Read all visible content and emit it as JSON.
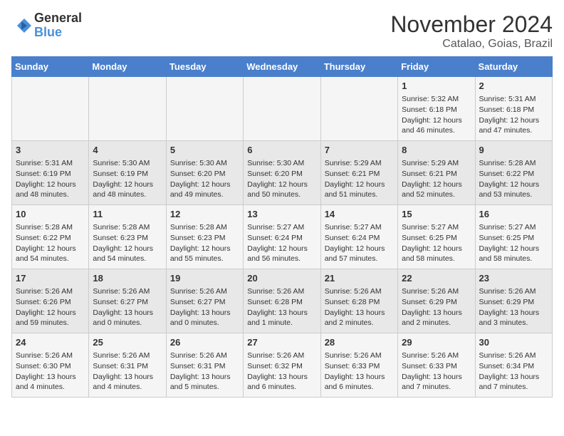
{
  "header": {
    "logo_line1": "General",
    "logo_line2": "Blue",
    "month": "November 2024",
    "location": "Catalao, Goias, Brazil"
  },
  "days_of_week": [
    "Sunday",
    "Monday",
    "Tuesday",
    "Wednesday",
    "Thursday",
    "Friday",
    "Saturday"
  ],
  "weeks": [
    [
      {
        "day": "",
        "content": ""
      },
      {
        "day": "",
        "content": ""
      },
      {
        "day": "",
        "content": ""
      },
      {
        "day": "",
        "content": ""
      },
      {
        "day": "",
        "content": ""
      },
      {
        "day": "1",
        "content": "Sunrise: 5:32 AM\nSunset: 6:18 PM\nDaylight: 12 hours and 46 minutes."
      },
      {
        "day": "2",
        "content": "Sunrise: 5:31 AM\nSunset: 6:18 PM\nDaylight: 12 hours and 47 minutes."
      }
    ],
    [
      {
        "day": "3",
        "content": "Sunrise: 5:31 AM\nSunset: 6:19 PM\nDaylight: 12 hours and 48 minutes."
      },
      {
        "day": "4",
        "content": "Sunrise: 5:30 AM\nSunset: 6:19 PM\nDaylight: 12 hours and 48 minutes."
      },
      {
        "day": "5",
        "content": "Sunrise: 5:30 AM\nSunset: 6:20 PM\nDaylight: 12 hours and 49 minutes."
      },
      {
        "day": "6",
        "content": "Sunrise: 5:30 AM\nSunset: 6:20 PM\nDaylight: 12 hours and 50 minutes."
      },
      {
        "day": "7",
        "content": "Sunrise: 5:29 AM\nSunset: 6:21 PM\nDaylight: 12 hours and 51 minutes."
      },
      {
        "day": "8",
        "content": "Sunrise: 5:29 AM\nSunset: 6:21 PM\nDaylight: 12 hours and 52 minutes."
      },
      {
        "day": "9",
        "content": "Sunrise: 5:28 AM\nSunset: 6:22 PM\nDaylight: 12 hours and 53 minutes."
      }
    ],
    [
      {
        "day": "10",
        "content": "Sunrise: 5:28 AM\nSunset: 6:22 PM\nDaylight: 12 hours and 54 minutes."
      },
      {
        "day": "11",
        "content": "Sunrise: 5:28 AM\nSunset: 6:23 PM\nDaylight: 12 hours and 54 minutes."
      },
      {
        "day": "12",
        "content": "Sunrise: 5:28 AM\nSunset: 6:23 PM\nDaylight: 12 hours and 55 minutes."
      },
      {
        "day": "13",
        "content": "Sunrise: 5:27 AM\nSunset: 6:24 PM\nDaylight: 12 hours and 56 minutes."
      },
      {
        "day": "14",
        "content": "Sunrise: 5:27 AM\nSunset: 6:24 PM\nDaylight: 12 hours and 57 minutes."
      },
      {
        "day": "15",
        "content": "Sunrise: 5:27 AM\nSunset: 6:25 PM\nDaylight: 12 hours and 58 minutes."
      },
      {
        "day": "16",
        "content": "Sunrise: 5:27 AM\nSunset: 6:25 PM\nDaylight: 12 hours and 58 minutes."
      }
    ],
    [
      {
        "day": "17",
        "content": "Sunrise: 5:26 AM\nSunset: 6:26 PM\nDaylight: 12 hours and 59 minutes."
      },
      {
        "day": "18",
        "content": "Sunrise: 5:26 AM\nSunset: 6:27 PM\nDaylight: 13 hours and 0 minutes."
      },
      {
        "day": "19",
        "content": "Sunrise: 5:26 AM\nSunset: 6:27 PM\nDaylight: 13 hours and 0 minutes."
      },
      {
        "day": "20",
        "content": "Sunrise: 5:26 AM\nSunset: 6:28 PM\nDaylight: 13 hours and 1 minute."
      },
      {
        "day": "21",
        "content": "Sunrise: 5:26 AM\nSunset: 6:28 PM\nDaylight: 13 hours and 2 minutes."
      },
      {
        "day": "22",
        "content": "Sunrise: 5:26 AM\nSunset: 6:29 PM\nDaylight: 13 hours and 2 minutes."
      },
      {
        "day": "23",
        "content": "Sunrise: 5:26 AM\nSunset: 6:29 PM\nDaylight: 13 hours and 3 minutes."
      }
    ],
    [
      {
        "day": "24",
        "content": "Sunrise: 5:26 AM\nSunset: 6:30 PM\nDaylight: 13 hours and 4 minutes."
      },
      {
        "day": "25",
        "content": "Sunrise: 5:26 AM\nSunset: 6:31 PM\nDaylight: 13 hours and 4 minutes."
      },
      {
        "day": "26",
        "content": "Sunrise: 5:26 AM\nSunset: 6:31 PM\nDaylight: 13 hours and 5 minutes."
      },
      {
        "day": "27",
        "content": "Sunrise: 5:26 AM\nSunset: 6:32 PM\nDaylight: 13 hours and 6 minutes."
      },
      {
        "day": "28",
        "content": "Sunrise: 5:26 AM\nSunset: 6:33 PM\nDaylight: 13 hours and 6 minutes."
      },
      {
        "day": "29",
        "content": "Sunrise: 5:26 AM\nSunset: 6:33 PM\nDaylight: 13 hours and 7 minutes."
      },
      {
        "day": "30",
        "content": "Sunrise: 5:26 AM\nSunset: 6:34 PM\nDaylight: 13 hours and 7 minutes."
      }
    ]
  ]
}
